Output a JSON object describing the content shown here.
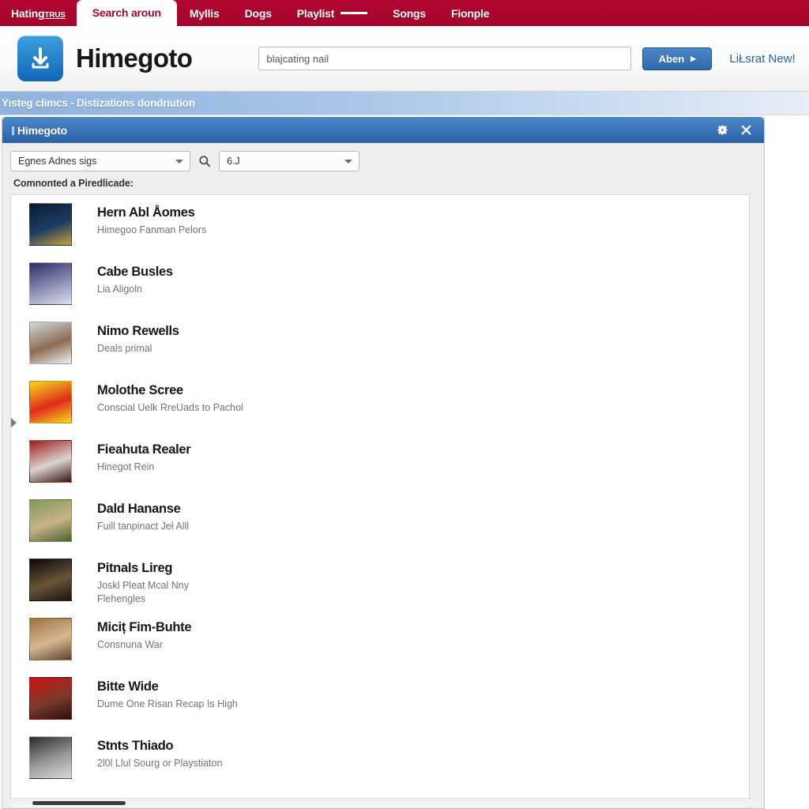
{
  "navbar": {
    "brand": "Hating",
    "brand_sub": "TRUS",
    "tabs": [
      {
        "label": "Search aroun",
        "active": true,
        "dash": false
      },
      {
        "label": "Myllis",
        "active": false,
        "dash": false
      },
      {
        "label": "Dogs",
        "active": false,
        "dash": false
      },
      {
        "label": "Playlist",
        "active": false,
        "dash": true
      },
      {
        "label": "Songs",
        "active": false,
        "dash": false
      },
      {
        "label": "Fionple",
        "active": false,
        "dash": false
      }
    ],
    "background_color": "#a3062c",
    "active_tab_color": "#a3062c"
  },
  "header": {
    "logo_icon": "download-icon",
    "brand_title": "Himegoto",
    "search": {
      "value": "blajcating nail",
      "placeholder": "blajcating nail"
    },
    "search_button": {
      "label": "Aben",
      "caret": "▶"
    },
    "header_link": "LiŁsrat New!",
    "accent_blue": "#2f6aad"
  },
  "breadcrumb": {
    "text": "Yısteg climcs - Distizations dondriution"
  },
  "window": {
    "title": "Himegoto",
    "controls": [
      {
        "name": "settings-icon",
        "glyph": "gear"
      },
      {
        "name": "close-icon",
        "glyph": "close"
      }
    ],
    "titlebar_color": "#2a62a7"
  },
  "toolbar": {
    "source_select": {
      "value": "Egnes Adnes sigs",
      "options": [
        "Egnes Adnes sigs"
      ]
    },
    "search_icon": "search-icon",
    "filter_select": {
      "value": "6.J",
      "options": [
        "6.J"
      ]
    },
    "section_label": "Comnonted a Piredlicade:"
  },
  "results": [
    {
      "title": "Hern Abl Åomes",
      "subtitle": "Himegoo Fanman Pelors",
      "art_colors": [
        "#0d1a33",
        "#1d3c63",
        "#c9a23a"
      ]
    },
    {
      "title": "Cabe Busles",
      "subtitle": "Lia Aligoln",
      "art_colors": [
        "#2b2f63",
        "#8c8fb5",
        "#dfe0ea"
      ]
    },
    {
      "title": "Nimo Rewells",
      "subtitle": "Deals primal",
      "art_colors": [
        "#cfd9de",
        "#8e6b53",
        "#eef2f4"
      ]
    },
    {
      "title": "Molothe Scree",
      "subtitle": "Conscial Uelk RreUads to Pachol",
      "art_colors": [
        "#f5dd1e",
        "#e02b1c",
        "#f5dd1e"
      ]
    },
    {
      "title": "Fieahuta Realer",
      "subtitle": "Hinegot Rein",
      "art_colors": [
        "#9e1a1a",
        "#d9d4cf",
        "#3a1212"
      ]
    },
    {
      "title": "Dald Hananse",
      "subtitle": "Fuill tanpinact Jeł Alll",
      "art_colors": [
        "#7d9a56",
        "#c9b28a",
        "#47632e"
      ]
    },
    {
      "title": "Pitnals Lireg",
      "subtitle": "Joskl Pleat Mcal Nny\nFlehengles",
      "art_colors": [
        "#090909",
        "#6a5438",
        "#1a1510"
      ]
    },
    {
      "title": "Miciț Fim-Buhte",
      "subtitle": "Consnuna War",
      "art_colors": [
        "#a0713f",
        "#d6b892",
        "#5a4330"
      ]
    },
    {
      "title": "Bitte Wide",
      "subtitle": "Dume One Risan Recap Is High",
      "art_colors": [
        "#cc1414",
        "#7a3a2a",
        "#2a1010"
      ]
    },
    {
      "title": "Stnts Thiado",
      "subtitle": "2l0l Llul Sourg or Playstiaton",
      "art_colors": [
        "#2b2b2b",
        "#9a9a9a",
        "#d8d8d8"
      ]
    }
  ],
  "scrollbar": {
    "name": "horizontal-scrollbar"
  }
}
